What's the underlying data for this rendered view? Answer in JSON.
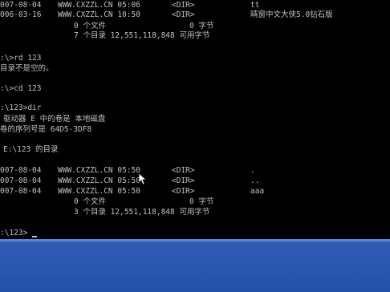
{
  "console": {
    "lines": [
      {
        "segs": [
          "007-08-04",
          "WWW.CXZZL.CN 05:06",
          "<DIR>",
          "tt"
        ]
      },
      {
        "segs": [
          "006-03-16",
          "WWW.CXZZL.CN 10:50",
          "<DIR>",
          "晴窗中文大侠5.0钻石版"
        ]
      },
      {
        "segs": [
          "0 个文件",
          "0 字节"
        ]
      },
      {
        "segs": [
          "7 个目录 12,551,118,848 可用字节"
        ]
      },
      {
        "segs": [
          ":\\>rd 123"
        ]
      },
      {
        "segs": [
          "目录不是空的。"
        ]
      },
      {
        "segs": [
          ":\\>cd 123"
        ]
      },
      {
        "segs": [
          ":\\123>dir"
        ]
      },
      {
        "segs": [
          "驱动器 E 中的卷是 本地磁盘"
        ]
      },
      {
        "segs": [
          "卷的序列号是 64D5-3DF8"
        ]
      },
      {
        "segs": [
          "E:\\123 的目录"
        ]
      },
      {
        "segs": [
          "007-08-04",
          "WWW.CXZZL.CN 05:50",
          "<DIR>",
          "."
        ]
      },
      {
        "segs": [
          "007-08-04",
          "WWW.CXZZL.CN 05:50",
          "<DIR>",
          ".."
        ]
      },
      {
        "segs": [
          "007-08-04",
          "WWW.CXZZL.CN 05:50",
          "<DIR>",
          "aaa"
        ]
      },
      {
        "segs": [
          "0 个文件",
          "0 字节"
        ]
      },
      {
        "segs": [
          "3 个目录 12,551,118,848 可用字节"
        ]
      },
      {
        "segs": [
          ":\\123>"
        ]
      }
    ]
  },
  "taskbar": {
    "color": "#2a56b0"
  }
}
